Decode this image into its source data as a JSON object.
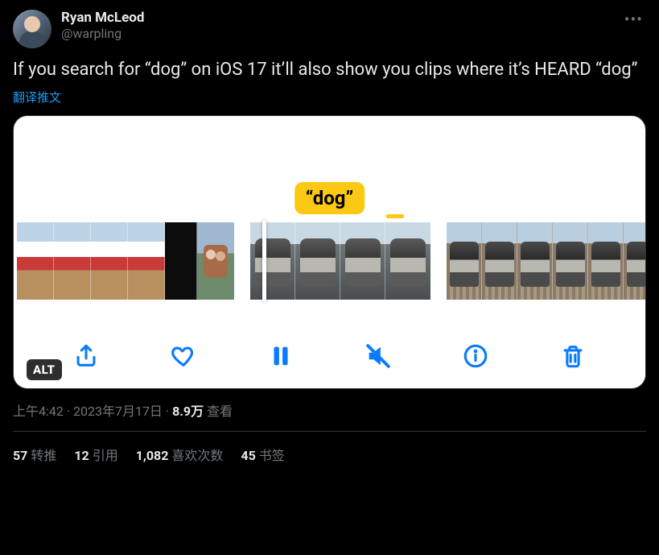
{
  "user": {
    "display_name": "Ryan McLeod",
    "handle": "@warpling"
  },
  "body": "If you search for “dog” on iOS 17 it’ll also show you clips where it’s HEARD “dog”",
  "translate_label": "翻译推文",
  "media": {
    "search_tag": "“dog”",
    "alt_badge": "ALT",
    "toolbar_icons": [
      "share-icon",
      "heart-icon",
      "pause-icon",
      "mute-icon",
      "info-icon",
      "trash-icon"
    ]
  },
  "meta": {
    "time": "上午4:42",
    "date": "2023年7月17日",
    "views_count": "8.9万",
    "views_label": "查看",
    "sep": " · "
  },
  "stats": {
    "retweets": {
      "count": "57",
      "label": "转推"
    },
    "quotes": {
      "count": "12",
      "label": "引用"
    },
    "likes": {
      "count": "1,082",
      "label": "喜欢次数"
    },
    "bookmarks": {
      "count": "45",
      "label": "书签"
    }
  }
}
